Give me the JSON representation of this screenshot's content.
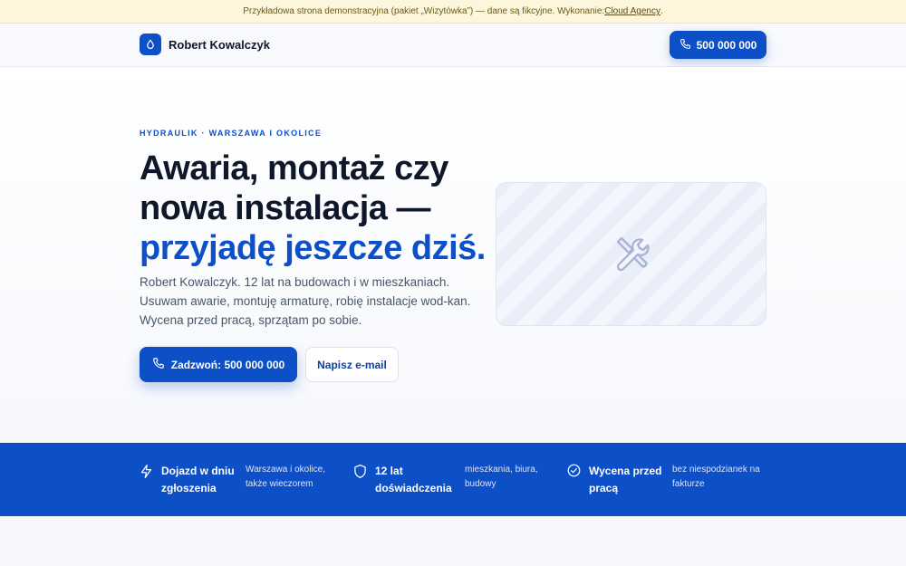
{
  "topbar": {
    "text": "Przykładowa strona demonstracyjna (pakiet „Wizytówka”) — dane są fikcyjne. Wykonanie: ",
    "link": "Cloud Agency",
    "suffix": "."
  },
  "header": {
    "brand_name": "Robert Kowalczyk",
    "logo_icon": "droplet-icon",
    "phone_label": "500 000 000",
    "phone_icon": "phone-icon"
  },
  "hero": {
    "eyebrow": "HYDRAULIK · WARSZAWA I OKOLICE",
    "headline_line1": "Awaria, montaż czy nowa instalacja —",
    "headline_accent": "przyjadę jeszcze dziś.",
    "lead": "Robert Kowalczyk. 12 lat na budowach i w mieszkaniach. Usuwam awarie, montuję armaturę, robię instalacje wod-kan. Wycena przed pracą, sprzątam po sobie.",
    "call_button": "Zadzwoń: 500 000 000",
    "email_button": "Napisz e-mail",
    "image_icon": "wrench-icon"
  },
  "features": [
    {
      "icon": "lightning-icon",
      "title": "Dojazd w dniu zgłoszenia",
      "desc": "Warszawa i okolice, także wieczorem"
    },
    {
      "icon": "shield-icon",
      "title": "12 lat doświadczenia",
      "desc": "mieszkania, biura, budowy"
    },
    {
      "icon": "check-circle-icon",
      "title": "Wycena przed pracą",
      "desc": "bez niespodzianek na fakturze"
    }
  ],
  "colors": {
    "accent": "#0d4fc7",
    "banner_bg": "#fdf6dd",
    "heading": "#0f172a"
  }
}
